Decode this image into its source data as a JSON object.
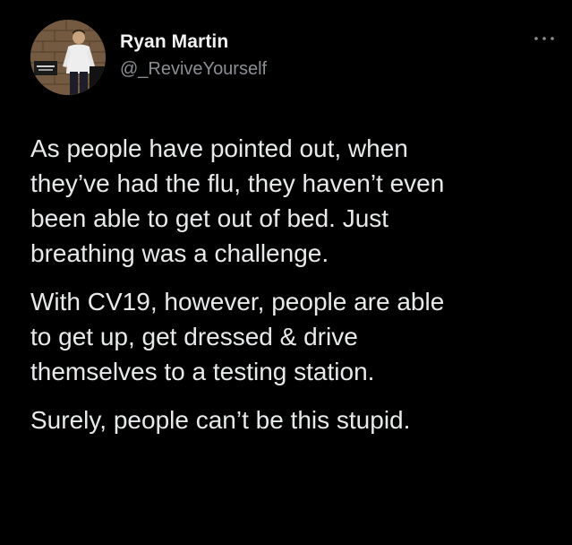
{
  "tweet": {
    "author": {
      "display_name": "Ryan Martin",
      "handle": "@_ReviveYourself",
      "avatar": "profile-photo"
    },
    "more_icon": "ellipsis-icon",
    "paragraphs": [
      {
        "lines": [
          "As people have pointed out, when",
          "they’ve had the flu, they haven’t even",
          "been able to get out of bed. Just",
          "breathing was a challenge."
        ]
      },
      {
        "lines": [
          "With CV19, however, people are able",
          "to get up, get dressed & drive",
          "themselves to a testing station."
        ]
      },
      {
        "lines": [
          "Surely, people can’t be this stupid."
        ]
      }
    ]
  },
  "colors": {
    "background": "#000000",
    "text": "#e7e9ea",
    "secondary_text": "#8b8f94"
  }
}
